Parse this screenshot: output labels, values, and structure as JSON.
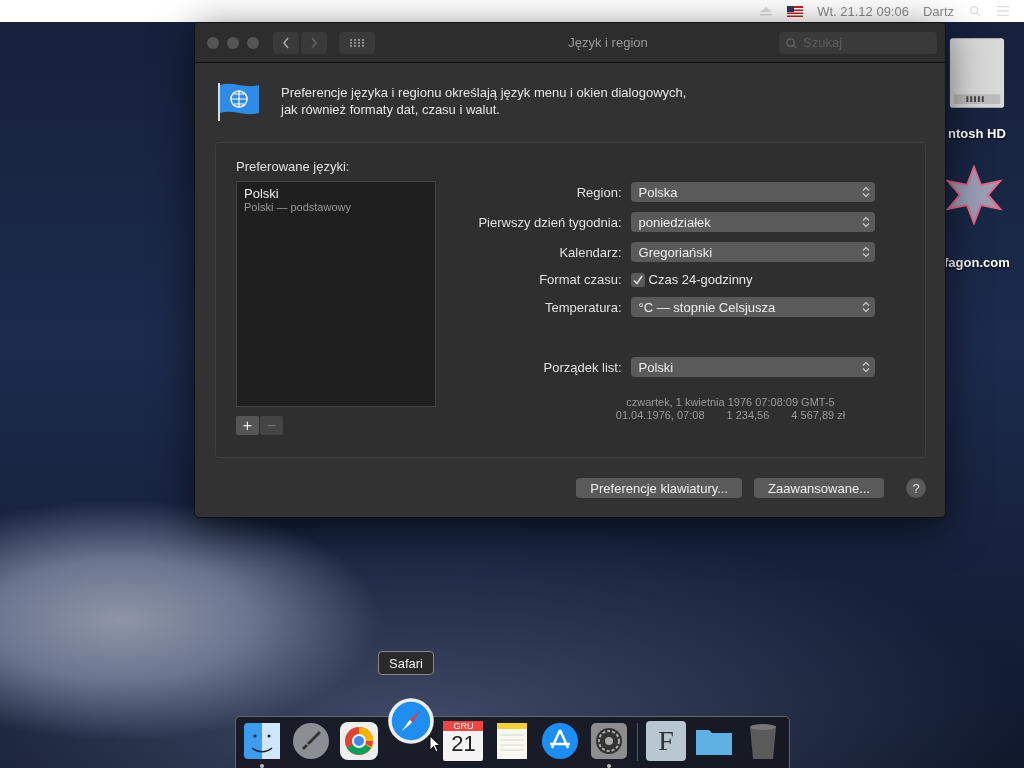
{
  "menu_bar": {
    "clock": "Wt. 21.12  09:06",
    "user": "Dartz"
  },
  "desktop_icons": [
    {
      "kind": "disk",
      "label": "ntosh HD"
    },
    {
      "kind": "star",
      "label": "fagon.com"
    }
  ],
  "window": {
    "title": "Język i region",
    "search": {
      "placeholder": "Szukaj"
    },
    "intro": "Preferencje języka i regionu określają język menu i okien dialogowych,\njak również formaty dat, czasu i walut.",
    "languages": {
      "heading": "Preferowane języki:",
      "items": [
        {
          "name": "Polski",
          "detail": "Polski — podstawowy"
        }
      ],
      "controls": [
        {
          "symbol": "+",
          "disabled": false
        },
        {
          "symbol": "−",
          "disabled": true
        }
      ]
    },
    "settings": [
      {
        "kind": "select",
        "label": "Region:",
        "value": "Polska"
      },
      {
        "kind": "select",
        "label": "Pierwszy dzień tygodnia:",
        "value": "poniedziałek"
      },
      {
        "kind": "select",
        "label": "Kalendarz:",
        "value": "Gregoriański"
      },
      {
        "kind": "checkbox",
        "label": "Format czasu:",
        "value": "Czas 24-godzinny",
        "checked": true
      },
      {
        "kind": "select",
        "label": "Temperatura:",
        "value": "°C — stopnie Celsjusza"
      }
    ],
    "collation": {
      "label": "Porządek list:",
      "value": "Polski"
    },
    "sample": {
      "long_date": "czwartek, 1 kwietnia 1976 07:08:09 GMT-5",
      "short_date": "01.04.1976, 07:08",
      "number": "1 234,56",
      "currency": "4 567,89 zł"
    },
    "buttons": [
      "Preferencje klawiatury...",
      "Zaawansowane..."
    ],
    "help": "?"
  },
  "dock": {
    "tooltip": "Safari",
    "apps": [
      {
        "kind": "finder",
        "running": true
      },
      {
        "kind": "launchpad",
        "running": false
      },
      {
        "kind": "chrome",
        "running": false
      },
      {
        "kind": "safari",
        "running": false
      },
      {
        "kind": "calendar",
        "running": false,
        "month": "GRU",
        "day": "21"
      },
      {
        "kind": "notes",
        "running": false
      },
      {
        "kind": "appstore",
        "running": false
      },
      {
        "kind": "settings",
        "running": true
      }
    ],
    "stacks": [
      {
        "kind": "font",
        "running": false,
        "letter": "F"
      },
      {
        "kind": "folder",
        "running": false
      },
      {
        "kind": "trash",
        "running": false
      }
    ]
  }
}
